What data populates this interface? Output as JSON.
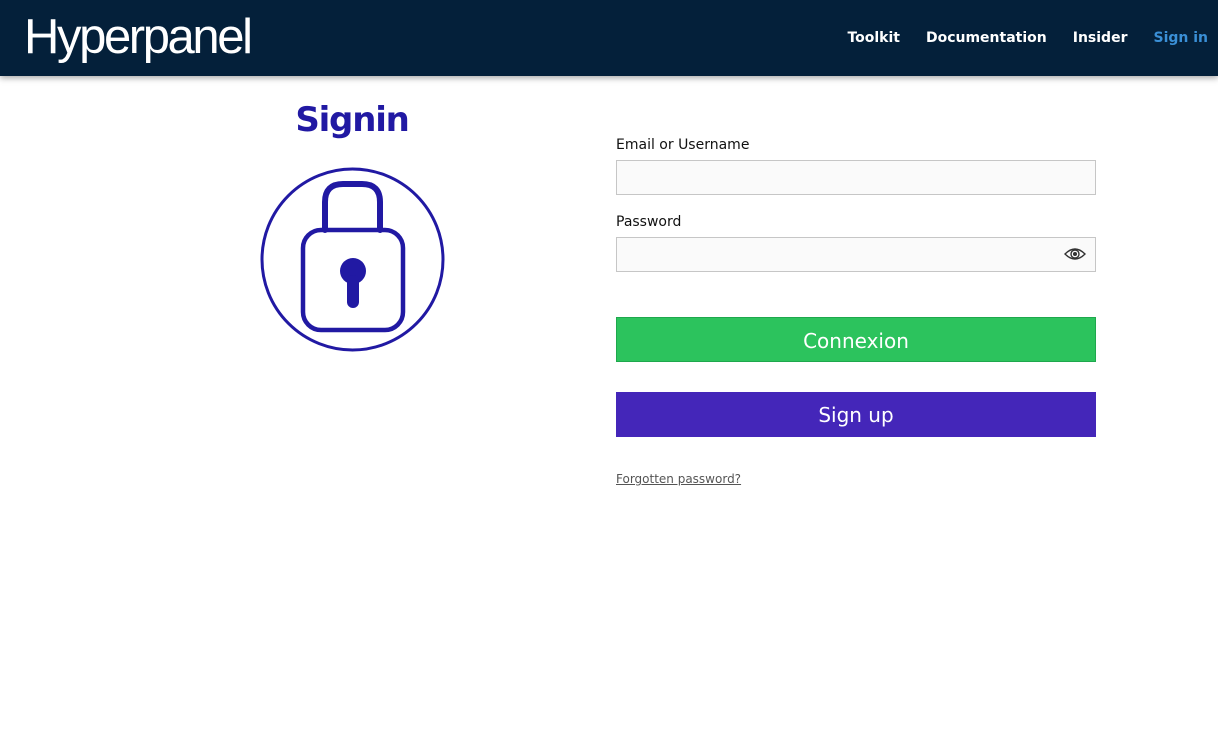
{
  "header": {
    "brand": "Hyperpanel",
    "nav": [
      {
        "label": "Toolkit"
      },
      {
        "label": "Documentation"
      },
      {
        "label": "Insider"
      },
      {
        "label": "Sign in"
      }
    ]
  },
  "main": {
    "title": "Signin",
    "icon": "lock-icon",
    "accent_color": "#2119a3"
  },
  "form": {
    "email_label": "Email or Username",
    "email_value": "",
    "password_label": "Password",
    "password_value": "",
    "password_toggle_icon": "eye-icon",
    "connect_label": "Connexion",
    "signup_label": "Sign up",
    "forgot_label": "Forgotten password?"
  },
  "colors": {
    "header_bg": "#04203a",
    "active_nav": "#3a8fd6",
    "connect_bg": "#2cc35d",
    "signup_bg": "#4426b9"
  }
}
